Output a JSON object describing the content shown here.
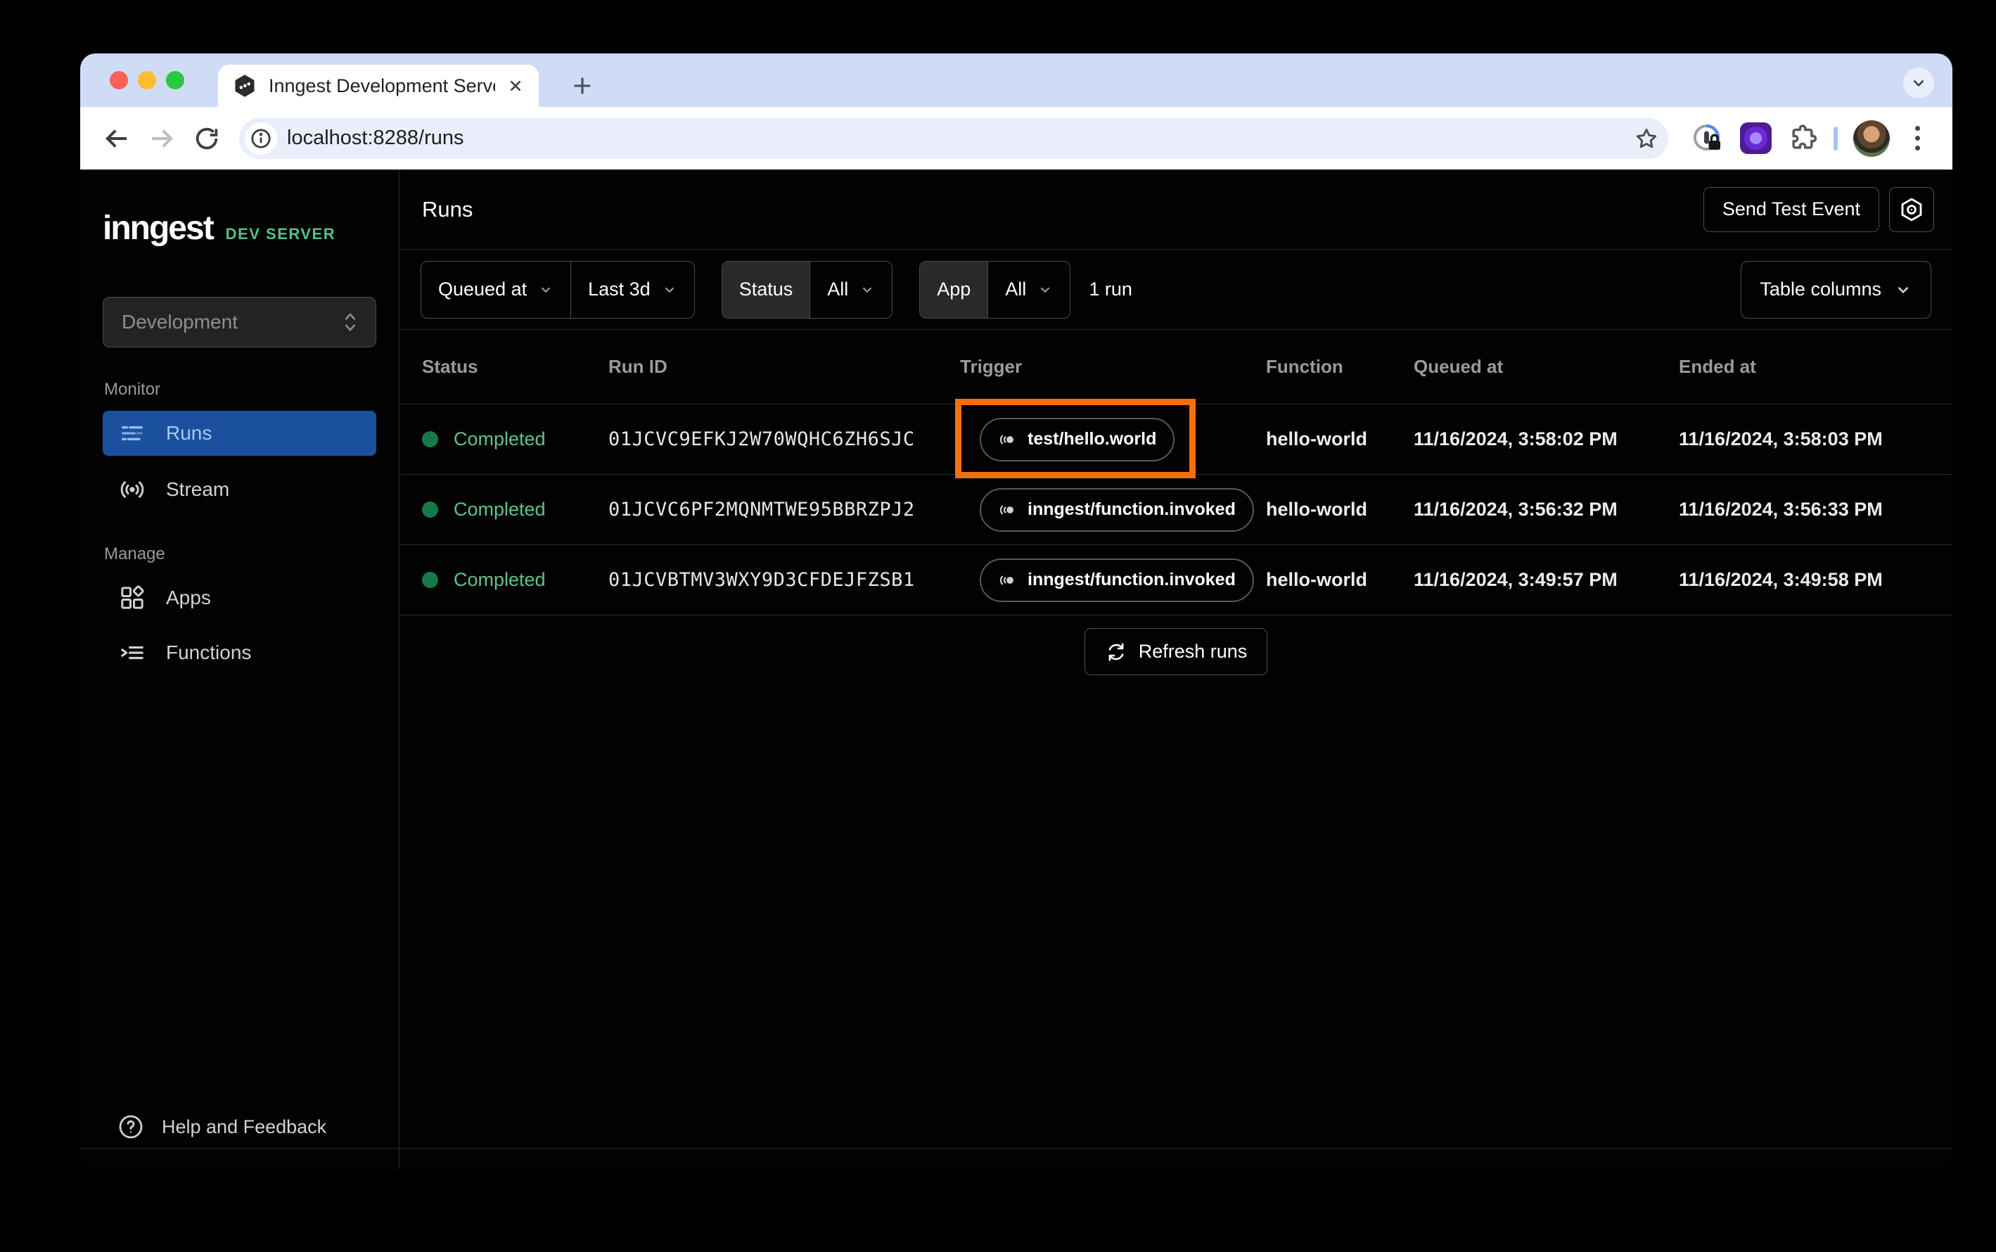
{
  "browser": {
    "tab_title": "Inngest Development Server",
    "url": "localhost:8288/runs",
    "icons": {
      "favicon": "inngest-hexagon-logo",
      "tab_close": "close-icon",
      "new_tab": "plus-icon",
      "back": "arrow-left-icon",
      "forward": "arrow-right-icon",
      "reload": "reload-icon",
      "site_info": "info-circle-icon",
      "bookmark": "star-icon",
      "password_manager": "password-manager-lock-icon",
      "extension_tile": "purple-extension-icon",
      "extensions": "puzzle-piece-icon",
      "profile": "user-avatar",
      "menu": "kebab-menu-icon"
    }
  },
  "sidebar": {
    "logo": "inngest",
    "logo_badge": "DEV SERVER",
    "env_selector": {
      "value": "Development",
      "icon": "up-down-chevrons-icon"
    },
    "sections": [
      {
        "label": "Monitor",
        "items": [
          {
            "label": "Runs",
            "icon": "runs-list-icon",
            "active": true
          },
          {
            "label": "Stream",
            "icon": "stream-broadcast-icon",
            "active": false
          }
        ]
      },
      {
        "label": "Manage",
        "items": [
          {
            "label": "Apps",
            "icon": "apps-grid-icon",
            "active": false
          },
          {
            "label": "Functions",
            "icon": "functions-list-icon",
            "active": false
          }
        ]
      }
    ],
    "footer": {
      "label": "Help and Feedback",
      "icon": "question-circle-icon"
    }
  },
  "header": {
    "title": "Runs",
    "send_test_event": "Send Test Event",
    "settings_icon": "gear-hexagon-icon"
  },
  "filters": {
    "field_label": "Queued at",
    "time_range": "Last 3d",
    "status_label": "Status",
    "status_value": "All",
    "app_label": "App",
    "app_value": "All",
    "run_count": "1 run",
    "table_columns": "Table columns"
  },
  "table": {
    "columns": [
      "Status",
      "Run ID",
      "Trigger",
      "Function",
      "Queued at",
      "Ended at"
    ],
    "rows": [
      {
        "status": "Completed",
        "run_id": "01JCVC9EFKJ2W70WQHC6ZH6SJC",
        "trigger": "test/hello.world",
        "function": "hello-world",
        "queued_at": "11/16/2024, 3:58:02 PM",
        "ended_at": "11/16/2024, 3:58:03 PM",
        "highlighted": true
      },
      {
        "status": "Completed",
        "run_id": "01JCVC6PF2MQNMTWE95BBRZPJ2",
        "trigger": "inngest/function.invoked",
        "function": "hello-world",
        "queued_at": "11/16/2024, 3:56:32 PM",
        "ended_at": "11/16/2024, 3:56:33 PM",
        "highlighted": false
      },
      {
        "status": "Completed",
        "run_id": "01JCVBTMV3WXY9D3CFDEJFZSB1",
        "trigger": "inngest/function.invoked",
        "function": "hello-world",
        "queued_at": "11/16/2024, 3:49:57 PM",
        "ended_at": "11/16/2024, 3:49:58 PM",
        "highlighted": false
      }
    ],
    "refresh_button": "Refresh runs"
  },
  "colors": {
    "accent_green": "#52c08f",
    "selected_nav_blue": "#1b509e",
    "status_green_text": "#62c18e",
    "status_green_dot": "#16794a",
    "highlight_orange": "#f4700e",
    "tabstrip_blue": "#cfdcf6"
  }
}
